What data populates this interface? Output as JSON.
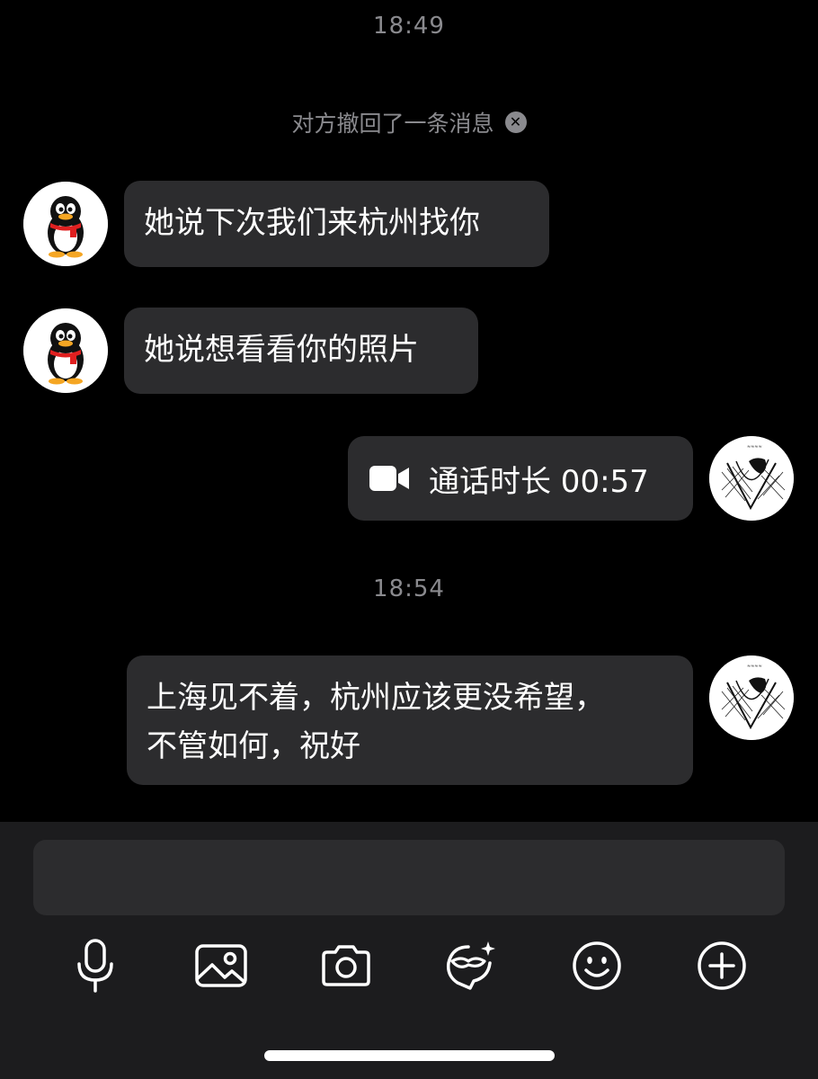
{
  "conversation": {
    "timestamp_1": "18:49",
    "recall_notice": "对方撤回了一条消息",
    "messages": [
      {
        "sender": "other",
        "text": "她说下次我们来杭州找你"
      },
      {
        "sender": "other",
        "text": "她说想看看你的照片"
      },
      {
        "sender": "self",
        "type": "video-call",
        "text": "通话时长 00:57",
        "icon": "video-camera-icon"
      },
      {
        "sender": "self",
        "text_line1": "上海见不着，杭州应该更没希望，",
        "text_line2": "不管如何，祝好"
      }
    ],
    "timestamp_2": "18:54"
  },
  "composer": {
    "input_value": "",
    "tools": [
      "microphone-icon",
      "image-icon",
      "camera-icon",
      "sticker-icon",
      "emoji-icon",
      "plus-icon"
    ]
  },
  "colors": {
    "background": "#000000",
    "bubble": "#2c2c2e",
    "composer": "#1c1c1e",
    "timestamp": "#8a8a8e"
  }
}
